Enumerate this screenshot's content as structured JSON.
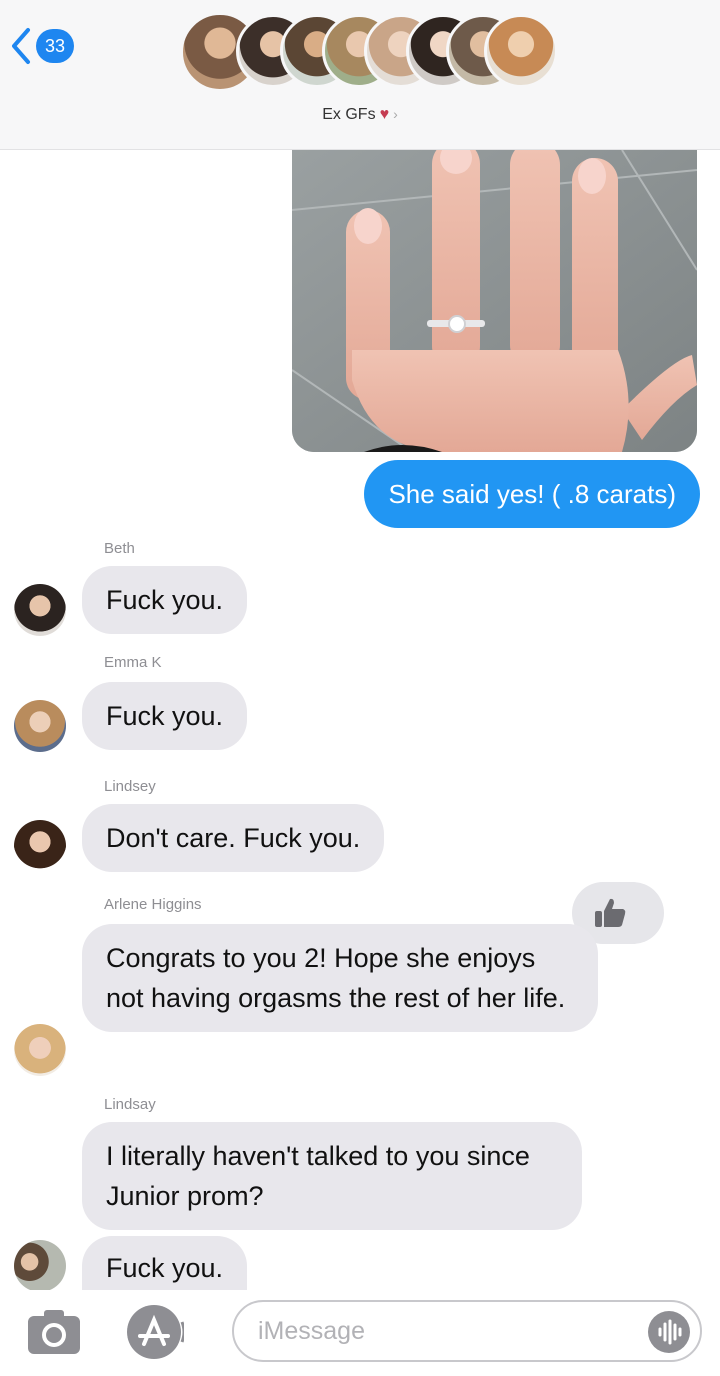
{
  "header": {
    "back_count": "33",
    "group_name": "Ex GFs",
    "heart": "♥",
    "chevron": "›"
  },
  "avatar_colors": [
    "#b08c74",
    "#5b4a40",
    "#cfa27e",
    "#7e8a6a",
    "#d9b8a0",
    "#6e5547",
    "#9a7458",
    "#c78a55"
  ],
  "thread": {
    "photo_alt": "hand with engagement ring",
    "sent_text": "She said yes! ( .8 carats)",
    "messages": [
      {
        "sender": "Beth",
        "text": "Fuck you."
      },
      {
        "sender": "Emma K",
        "text": "Fuck you."
      },
      {
        "sender": "Lindsey",
        "text": "Don't care. Fuck you."
      },
      {
        "sender": "Arlene Higgins",
        "text": "Congrats to you 2! Hope she enjoys not having orgasms the rest of her life."
      },
      {
        "sender": "Lindsay",
        "text": "I literally haven't talked to you since Junior prom?"
      },
      {
        "sender": "",
        "text": "Fuck you."
      }
    ],
    "tapback": "thumbs-up-icon"
  },
  "composer": {
    "placeholder": "iMessage",
    "value": ""
  },
  "colors": {
    "accent": "#2196f3",
    "received_bubble": "#e8e7ec"
  }
}
